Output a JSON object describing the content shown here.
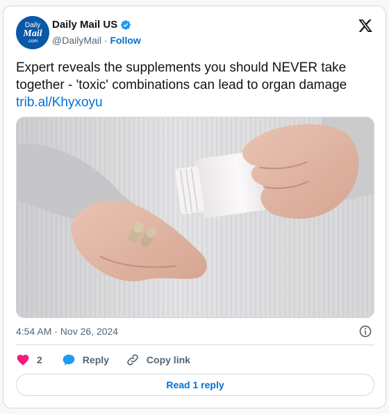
{
  "account": {
    "avatar_lines": [
      "Daily",
      "Mail",
      ".com"
    ],
    "name": "Daily Mail US",
    "handle": "@DailyMail",
    "separator": "·",
    "follow_label": "Follow"
  },
  "tweet": {
    "text": "Expert reveals the supplements you should NEVER take together - 'toxic' combinations can lead to organ damage",
    "link": "trib.al/Khyxoyu",
    "media_alt": "Hand holding two capsules while the other hand tips a white pill bottle"
  },
  "meta": {
    "timestamp": "4:54 AM · Nov 26, 2024"
  },
  "actions": {
    "like_count": "2",
    "reply_label": "Reply",
    "copy_link_label": "Copy link",
    "read_replies_label": "Read 1 reply"
  },
  "colors": {
    "link": "#006fd6",
    "like": "#f91880",
    "reply_icon": "#1d9bf0",
    "avatar_bg": "#0a58a8"
  },
  "icons": [
    "verified-badge-icon",
    "x-logo-icon",
    "info-icon",
    "heart-icon",
    "reply-bubble-icon",
    "link-icon"
  ]
}
